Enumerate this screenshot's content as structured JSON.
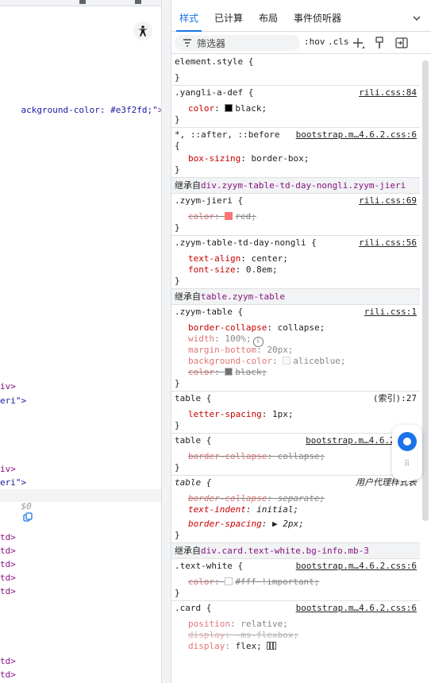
{
  "left_panel": {
    "lines": [
      {
        "text_attr": "ackground-color: #e3f2fd;\"",
        "text_tag": ">",
        "badge": "•••"
      },
      {
        "text_tag": "iv>"
      },
      {
        "text_str": "eri\">"
      },
      {
        "text_tag": "iv>"
      },
      {
        "text_str": "eri\">"
      },
      {
        "text_gray": "$0"
      },
      {
        "text_tag": "td>"
      },
      {
        "text_tag": "td>"
      },
      {
        "text_tag": "td>"
      },
      {
        "text_tag": "td>"
      },
      {
        "text_tag": "td>"
      },
      {
        "text_tag": "td>"
      },
      {
        "text_tag": "td>"
      }
    ]
  },
  "tabs": [
    {
      "label": "样式",
      "active": true
    },
    {
      "label": "已计算"
    },
    {
      "label": "布局"
    },
    {
      "label": "事件侦听器"
    }
  ],
  "toolbar": {
    "filter_placeholder": "筛选器",
    "hov": ":hov",
    "cls": ".cls"
  },
  "rules": [
    {
      "selector": "element.style {",
      "source": "",
      "decls": []
    },
    {
      "selector": ".yangli-a-def {",
      "source": "rili.css:84",
      "decls": [
        {
          "name": "color",
          "value": "black",
          "swatch": "#000000"
        }
      ]
    },
    {
      "selector": "*, ::after, ::before",
      "selector2": "{",
      "source": "bootstrap.m…4.6.2.css:6",
      "decls": [
        {
          "name": "box-sizing",
          "value": "border-box"
        }
      ]
    },
    {
      "inherit_prefix": "继承自",
      "inherit_target": "div.zyym-table-td-day-nongli.zyym-jieri"
    },
    {
      "selector": ".zyym-jieri {",
      "source": "rili.css:69",
      "decls": [
        {
          "name": "color",
          "value": "red",
          "swatch": "#ff0000",
          "overridden": true
        }
      ]
    },
    {
      "selector": ".zyym-table-td-day-nongli {",
      "source": "rili.css:56",
      "decls": [
        {
          "name": "text-align",
          "value": "center"
        },
        {
          "name": "font-size",
          "value": "0.8em"
        }
      ]
    },
    {
      "inherit_prefix": "继承自",
      "inherit_target": "table.zyym-table"
    },
    {
      "selector": ".zyym-table {",
      "source": "rili.css:1",
      "decls": [
        {
          "name": "border-collapse",
          "value": "collapse"
        },
        {
          "name": "width",
          "value": "100%",
          "dim": true,
          "info": "i"
        },
        {
          "name": "margin-bottom",
          "value": "20px",
          "dim": true
        },
        {
          "name": "background-color",
          "value": "aliceblue",
          "dim": true,
          "swatch": "#f0f8ff"
        },
        {
          "name": "color",
          "value": "black",
          "swatch": "#000000",
          "overridden": true
        }
      ]
    },
    {
      "selector": "table {",
      "source": "(索引):27",
      "source_plain": true,
      "decls": [
        {
          "name": "letter-spacing",
          "value": "1px"
        }
      ]
    },
    {
      "selector": "table {",
      "source": "bootstrap.m…4.6.2.c",
      "decls": [
        {
          "name": "border-collapse",
          "value": "collapse",
          "overridden": true
        }
      ]
    },
    {
      "selector": "table {",
      "selector_italic": true,
      "source": "用户代理样式表",
      "source_italic": true,
      "decls": [
        {
          "name": "border-collapse",
          "value": "separate",
          "overridden": true,
          "italic": true
        },
        {
          "name": "text-indent",
          "value": "initial",
          "italic": true
        },
        {
          "name": "border-spacing",
          "value": "2px",
          "italic": true,
          "triangle": "▶"
        }
      ]
    },
    {
      "inherit_prefix": "继承自",
      "inherit_target": "div.card.text-white.bg-info.mb-3"
    },
    {
      "selector": ".text-white {",
      "source": "bootstrap.m…4.6.2.css:6",
      "decls": [
        {
          "name": "color",
          "value": "#fff !important",
          "swatch": "#ffffff",
          "overridden": true
        }
      ]
    },
    {
      "selector": ".card {",
      "source": "bootstrap.m…4.6.2.css:6",
      "decls": [
        {
          "name": "position",
          "value": "relative",
          "dim": true
        },
        {
          "name": "display",
          "value": "-ms-flexbox",
          "dim": true,
          "overridden": true
        },
        {
          "name": "display",
          "value": "flex",
          "dim": true,
          "grid": true
        }
      ]
    }
  ],
  "colors": {
    "accent": "#1a73e8",
    "prop": "#c80000",
    "tag": "#881280"
  }
}
